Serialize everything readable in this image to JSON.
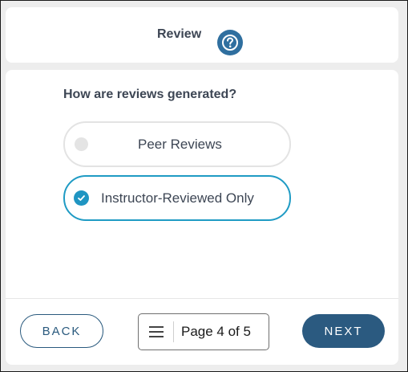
{
  "header": {
    "title": "Review",
    "help_icon": "question-circle-icon"
  },
  "main": {
    "question": "How are reviews generated?",
    "options": [
      {
        "label": "Peer Reviews",
        "selected": false
      },
      {
        "label": "Instructor-Reviewed Only",
        "selected": true
      }
    ],
    "accent_color": "#1f95c2"
  },
  "footer": {
    "back_label": "BACK",
    "next_label": "NEXT",
    "page_label": "Page 4 of 5",
    "menu_icon": "hamburger-menu-icon"
  },
  "colors": {
    "primary": "#2b5a80",
    "text": "#3d4654",
    "background": "#ededed"
  }
}
